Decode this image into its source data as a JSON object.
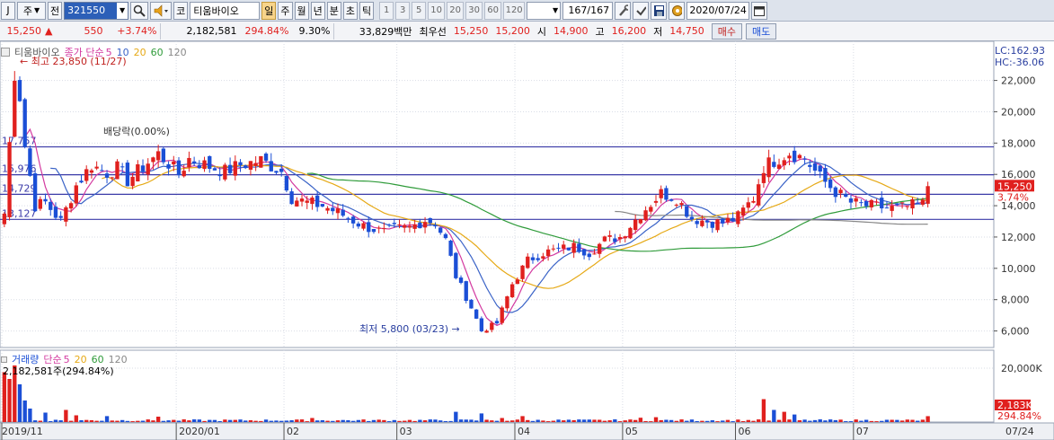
{
  "toolbar": {
    "btn_j": "J",
    "period_sel": "주",
    "prev": "전",
    "code": "321550",
    "search_icon": "search-icon",
    "sound_icon": "speaker-icon",
    "market_tag": "코",
    "stock_name": "티움바이오",
    "cycles": [
      "일",
      "주",
      "월",
      "년",
      "분",
      "초",
      "틱"
    ],
    "active_cycle": "일",
    "numbers": [
      "1",
      "3",
      "5",
      "10",
      "20",
      "30",
      "60",
      "120"
    ],
    "count": "167/167",
    "date": "2020/07/24"
  },
  "quote": {
    "price": "15,250",
    "change_arrow": "▲",
    "change": "550",
    "change_pct": "+3.74%",
    "volume": "2,182,581",
    "volume_ratio": "294.84%",
    "turnover": "9.30%",
    "amount": "33,829백만",
    "best_label": "최우선",
    "best_ask": "15,250",
    "best_bid": "15,200",
    "open_label": "시",
    "open": "14,900",
    "high_label": "고",
    "high": "16,200",
    "low_label": "저",
    "low": "14,750",
    "buy_label": "매수",
    "sell_label": "매도"
  },
  "price_legend": {
    "name": "티움바이오",
    "type": "종가 단순",
    "mas": [
      "5",
      "10",
      "20",
      "60",
      "120"
    ]
  },
  "volume_legend": {
    "name": "거래량",
    "type": "단순",
    "mas": [
      "5",
      "20",
      "60",
      "120"
    ],
    "current": "2,182,581주(294.84%)"
  },
  "annotations": {
    "high": "최고 23,850 (11/27)",
    "low": "최저 5,800 (03/23)",
    "dividend": "배당락(0.00%)",
    "lc": "LC:162.93",
    "hc": "HC:-36.06",
    "price_tag": "15,250",
    "pct_tag": "3.74%",
    "vol_tag": "2,183K",
    "vol_pct_tag": "294.84%"
  },
  "levels": [
    {
      "label": "17,757",
      "value": 17757
    },
    {
      "label": "15,976",
      "value": 15976
    },
    {
      "label": "14,729",
      "value": 14729
    },
    {
      "label": "13,127",
      "value": 13127
    }
  ],
  "colors": {
    "up": "#e0201e",
    "down": "#1b4fd6",
    "ma5": "#d33aa0",
    "ma10": "#3a63c7",
    "ma20": "#e6a916",
    "ma60": "#2f9b3a",
    "ma120": "#888888",
    "level": "#3a3aa8"
  },
  "chart_data": [
    {
      "type": "candlestick",
      "title": "티움바이오",
      "ylim": [
        5000,
        24500
      ],
      "yticks": [
        "22,000",
        "20,000",
        "18,000",
        "16,000",
        "14,000",
        "12,000",
        "10,000",
        "8,000",
        "6,000"
      ],
      "ytick_values": [
        22000,
        20000,
        18000,
        16000,
        14000,
        12000,
        10000,
        8000,
        6000
      ],
      "xticks": [
        "2019/11",
        "2020/01",
        "02",
        "03",
        "04",
        "05",
        "06",
        "07",
        "07/24"
      ],
      "xtick_index": [
        0,
        34,
        55,
        77,
        100,
        121,
        143,
        166,
        192
      ],
      "anchors": [
        [
          0,
          13500
        ],
        [
          2,
          22500
        ],
        [
          3,
          21000
        ],
        [
          4,
          17800
        ],
        [
          6,
          14000
        ],
        [
          8,
          14200
        ],
        [
          11,
          13000
        ],
        [
          14,
          15300
        ],
        [
          17,
          16600
        ],
        [
          20,
          16100
        ],
        [
          22,
          16400
        ],
        [
          24,
          15600
        ],
        [
          27,
          16500
        ],
        [
          30,
          17300
        ],
        [
          32,
          16700
        ],
        [
          34,
          16000
        ],
        [
          36,
          17000
        ],
        [
          40,
          16500
        ],
        [
          43,
          16200
        ],
        [
          46,
          16600
        ],
        [
          50,
          16900
        ],
        [
          54,
          16200
        ],
        [
          56,
          14500
        ],
        [
          59,
          14200
        ],
        [
          62,
          14000
        ],
        [
          66,
          13400
        ],
        [
          70,
          12700
        ],
        [
          74,
          12300
        ],
        [
          76,
          12500
        ],
        [
          79,
          12600
        ],
        [
          82,
          13100
        ],
        [
          84,
          12900
        ],
        [
          86,
          11800
        ],
        [
          88,
          9500
        ],
        [
          91,
          7500
        ],
        [
          93,
          6000
        ],
        [
          96,
          6500
        ],
        [
          99,
          9000
        ],
        [
          102,
          10500
        ],
        [
          105,
          11000
        ],
        [
          108,
          11200
        ],
        [
          111,
          11400
        ],
        [
          114,
          11000
        ],
        [
          117,
          11800
        ],
        [
          120,
          12000
        ],
        [
          124,
          13500
        ],
        [
          128,
          14800
        ],
        [
          131,
          14500
        ],
        [
          134,
          13200
        ],
        [
          137,
          13000
        ],
        [
          140,
          12900
        ],
        [
          143,
          13300
        ],
        [
          146,
          14500
        ],
        [
          148,
          16500
        ],
        [
          150,
          16900
        ],
        [
          153,
          17400
        ],
        [
          156,
          17000
        ],
        [
          159,
          15800
        ],
        [
          162,
          14900
        ],
        [
          165,
          14200
        ],
        [
          168,
          14000
        ],
        [
          171,
          13900
        ],
        [
          174,
          13800
        ],
        [
          177,
          14000
        ],
        [
          179,
          14100
        ],
        [
          180,
          15250
        ]
      ],
      "last_index": 180,
      "last_close": 15250
    },
    {
      "type": "bar",
      "title": "거래량",
      "ylim": [
        0,
        24000
      ],
      "yticks": [
        "20,000K"
      ],
      "ytick_values": [
        20000
      ],
      "unit": "K",
      "big_volumes": [
        [
          0,
          18500
        ],
        [
          1,
          16000
        ],
        [
          2,
          21000
        ],
        [
          3,
          14000
        ],
        [
          4,
          8000
        ],
        [
          5,
          5000
        ],
        [
          8,
          3500
        ],
        [
          12,
          4500
        ],
        [
          14,
          2500
        ],
        [
          20,
          2200
        ],
        [
          30,
          2000
        ],
        [
          60,
          1500
        ],
        [
          88,
          3800
        ],
        [
          93,
          3200
        ],
        [
          97,
          1500
        ],
        [
          101,
          2200
        ],
        [
          124,
          1600
        ],
        [
          127,
          1800
        ],
        [
          148,
          8500
        ],
        [
          150,
          4500
        ],
        [
          152,
          3800
        ],
        [
          154,
          2800
        ],
        [
          180,
          2183
        ]
      ]
    }
  ]
}
